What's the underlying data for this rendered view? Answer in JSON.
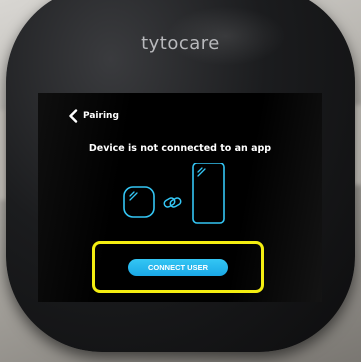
{
  "device": {
    "brand": "tytocare"
  },
  "screen": {
    "back_icon": "chevron-left-icon",
    "title": "Pairing",
    "status_text": "Device is not connected to an app",
    "illustration": {
      "device_icon": "rounded-square-device-icon",
      "link_icon": "chain-link-icon",
      "phone_icon": "smartphone-icon",
      "line_color": "#34c6f4"
    },
    "connect_button_label": "CONNECT USER",
    "accent_color": "#34c6f4"
  },
  "annotation": {
    "highlight_color": "#f4ee11"
  }
}
